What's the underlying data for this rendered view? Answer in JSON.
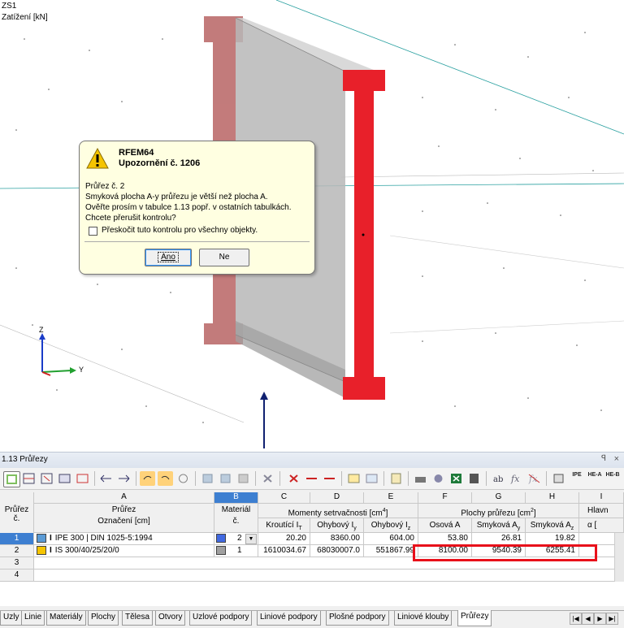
{
  "viewport": {
    "case_label": "ZS1",
    "load_label": "Zatížení [kN]",
    "axis_z": "Z",
    "axis_y": "Y"
  },
  "dialog": {
    "app": "RFEM64",
    "title": "Upozornění č. 1206",
    "lines": [
      "Průřez  č. 2",
      "Smyková plocha A-y průřezu je větší než plocha A.",
      "Ověřte prosím v tabulce 1.13 popř. v ostatních tabulkách.",
      "Chcete přerušit kontrolu?"
    ],
    "checkbox_label": "Přeskočit tuto kontrolu pro všechny objekty.",
    "yes": "Ano",
    "no": "Ne"
  },
  "panel": {
    "title": "1.13 Průřezy",
    "pin": "ꟼ",
    "close": "×",
    "toolbar_text": {
      "ipe": "IPE",
      "hea": "HE-A",
      "heb": "HE-B"
    }
  },
  "table": {
    "col_letters": [
      "A",
      "B",
      "C",
      "D",
      "E",
      "F",
      "G",
      "H",
      "I"
    ],
    "rowhdr_top": "Průřez",
    "rowhdr_bot": "č.",
    "group_a_top": "Průřez",
    "group_a_bot": "Označení [cm]",
    "group_b_top": "Materiál",
    "group_b_bot": "č.",
    "group_moments": "Momenty setrvačnosti [cm",
    "group_moments_sup": "4",
    "group_moments_end": "]",
    "group_areas": "Plochy průřezu [cm",
    "group_areas_sup": "2",
    "group_areas_end": "]",
    "group_i": "Hlavn",
    "sub_c": "Kroutící I",
    "sub_c_sub": "T",
    "sub_d": "Ohybový I",
    "sub_d_sub": "y",
    "sub_e": "Ohybový I",
    "sub_e_sub": "z",
    "sub_f": "Osová A",
    "sub_g": "Smyková A",
    "sub_g_sub": "y",
    "sub_h": "Smyková A",
    "sub_h_sub": "z",
    "sub_i": "α [",
    "rows": [
      {
        "no": "1",
        "name": "IPE 300 | DIN 1025-5:1994",
        "color": "#5b9bd5",
        "mat": "2",
        "mat_color": "#4169e1",
        "c": "20.20",
        "d": "8360.00",
        "e": "604.00",
        "f": "53.80",
        "g": "26.81",
        "h": "19.82"
      },
      {
        "no": "2",
        "name": "IS 300/40/25/20/0",
        "color": "#f5c400",
        "mat": "1",
        "mat_color": "#a0a0a0",
        "c": "1610034.67",
        "d": "68030007.0",
        "e": "551867.99",
        "f": "8100.00",
        "g": "9540.39",
        "h": "6255.41"
      },
      {
        "no": "3",
        "name": "",
        "color": "",
        "mat": "",
        "mat_color": "",
        "c": "",
        "d": "",
        "e": "",
        "f": "",
        "g": "",
        "h": ""
      },
      {
        "no": "4",
        "name": "",
        "color": "",
        "mat": "",
        "mat_color": "",
        "c": "",
        "d": "",
        "e": "",
        "f": "",
        "g": "",
        "h": ""
      }
    ]
  },
  "tabs": [
    "Uzly",
    "Linie",
    "Materiály",
    "Plochy",
    "Tělesa",
    "Otvory",
    "Uzlové podpory",
    "Liniové podpory",
    "Plošné podpory",
    "Liniové klouby",
    "Průřezy"
  ],
  "active_tab": "Průřezy",
  "colors": {
    "highlight": "#e8101a",
    "section_red": "#e8202a",
    "selection": "#3d7fd1"
  }
}
